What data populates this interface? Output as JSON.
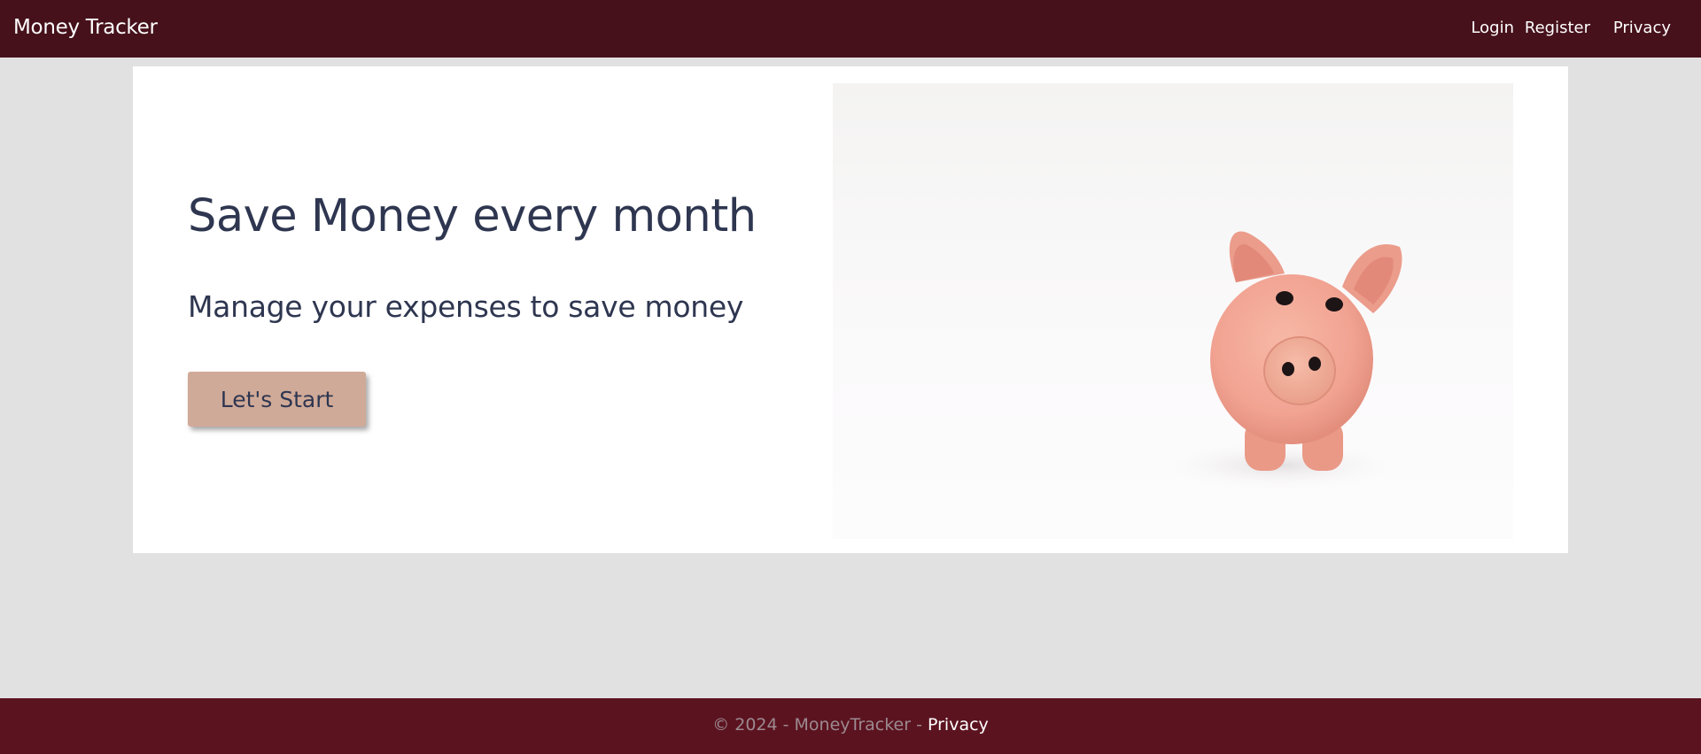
{
  "app": {
    "brand": "Money Tracker"
  },
  "nav": {
    "items": [
      {
        "label": "Login"
      },
      {
        "label": "Register"
      },
      {
        "label": "Privacy"
      }
    ]
  },
  "hero": {
    "title": "Save Money every month",
    "subtitle": "Manage your expenses to save money",
    "cta_label": "Let's Start",
    "image_icon": "piggy-bank"
  },
  "footer": {
    "copyright": "© 2024 - MoneyTracker - ",
    "privacy_label": "Privacy"
  },
  "colors": {
    "navbar_bg": "#46111b",
    "footer_bg": "#5c1320",
    "page_bg": "#e1e1e1",
    "heading": "#2e3650",
    "button_bg": "#d0aa98",
    "pig": "#f2a896"
  }
}
